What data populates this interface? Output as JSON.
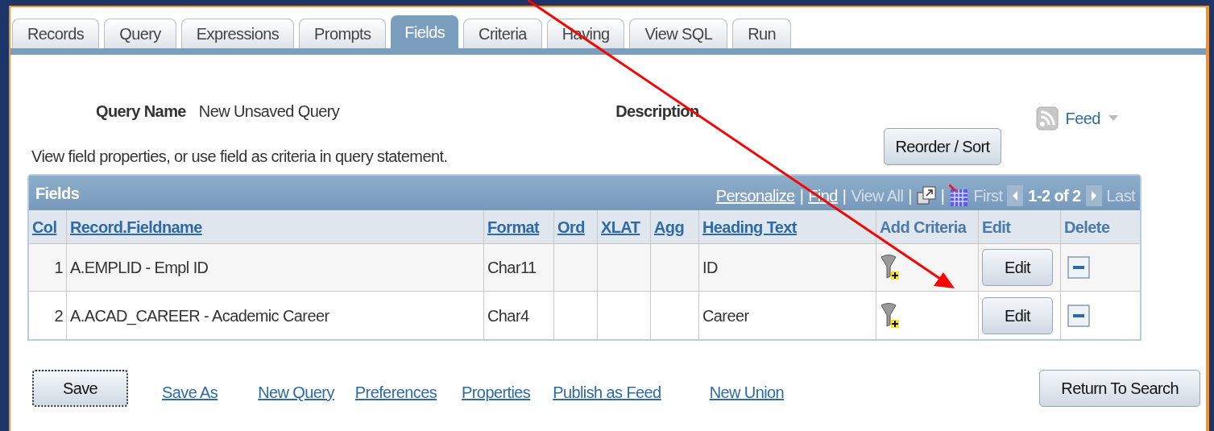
{
  "tabs": [
    {
      "label": "Records",
      "selected": false
    },
    {
      "label": "Query",
      "selected": false
    },
    {
      "label": "Expressions",
      "selected": false
    },
    {
      "label": "Prompts",
      "selected": false
    },
    {
      "label": "Fields",
      "selected": true
    },
    {
      "label": "Criteria",
      "selected": false
    },
    {
      "label": "Having",
      "selected": false
    },
    {
      "label": "View SQL",
      "selected": false
    },
    {
      "label": "Run",
      "selected": false
    }
  ],
  "query_name": {
    "label": "Query Name",
    "value": "New Unsaved Query"
  },
  "description": {
    "label": "Description"
  },
  "feed": {
    "label": "Feed"
  },
  "instruction": "View field properties, or use field as criteria in query statement.",
  "reorder_button": "Reorder / Sort",
  "grid": {
    "title": "Fields",
    "nav": [
      {
        "kind": "link",
        "text": "Personalize",
        "disabled": false
      },
      {
        "kind": "separator",
        "text": "|"
      },
      {
        "kind": "link",
        "text": "Find",
        "disabled": false
      },
      {
        "kind": "separator",
        "text": "|"
      },
      {
        "kind": "link",
        "text": "View All",
        "disabled": true
      },
      {
        "kind": "separator",
        "text": "|"
      },
      {
        "kind": "zoom"
      },
      {
        "kind": "separator",
        "text": "|"
      },
      {
        "kind": "download"
      },
      {
        "kind": "link",
        "text": "First",
        "disabled": true
      },
      {
        "kind": "prev"
      },
      {
        "kind": "count",
        "text": "1-2 of 2"
      },
      {
        "kind": "next"
      },
      {
        "kind": "link",
        "text": "Last",
        "disabled": true
      }
    ],
    "columns": [
      {
        "label": "Col",
        "sortable": true
      },
      {
        "label": "Record.Fieldname",
        "sortable": true
      },
      {
        "label": "Format",
        "sortable": true
      },
      {
        "label": "Ord",
        "sortable": true
      },
      {
        "label": "XLAT",
        "sortable": true
      },
      {
        "label": "Agg",
        "sortable": true
      },
      {
        "label": "Heading Text",
        "sortable": true
      },
      {
        "label": "Add Criteria",
        "sortable": false
      },
      {
        "label": "Edit",
        "sortable": false
      },
      {
        "label": "Delete",
        "sortable": false
      }
    ],
    "rows": [
      {
        "col": "1",
        "field": "A.EMPLID - Empl ID",
        "format": "Char11",
        "heading": "ID",
        "edit": "Edit"
      },
      {
        "col": "2",
        "field": "A.ACAD_CAREER - Academic Career",
        "format": "Char4",
        "heading": "Career",
        "edit": "Edit"
      }
    ]
  },
  "footer": {
    "save": "Save",
    "links": [
      "Save As",
      "New Query",
      "Preferences",
      "Properties",
      "Publish as Feed",
      "New Union"
    ],
    "return": "Return To Search"
  }
}
